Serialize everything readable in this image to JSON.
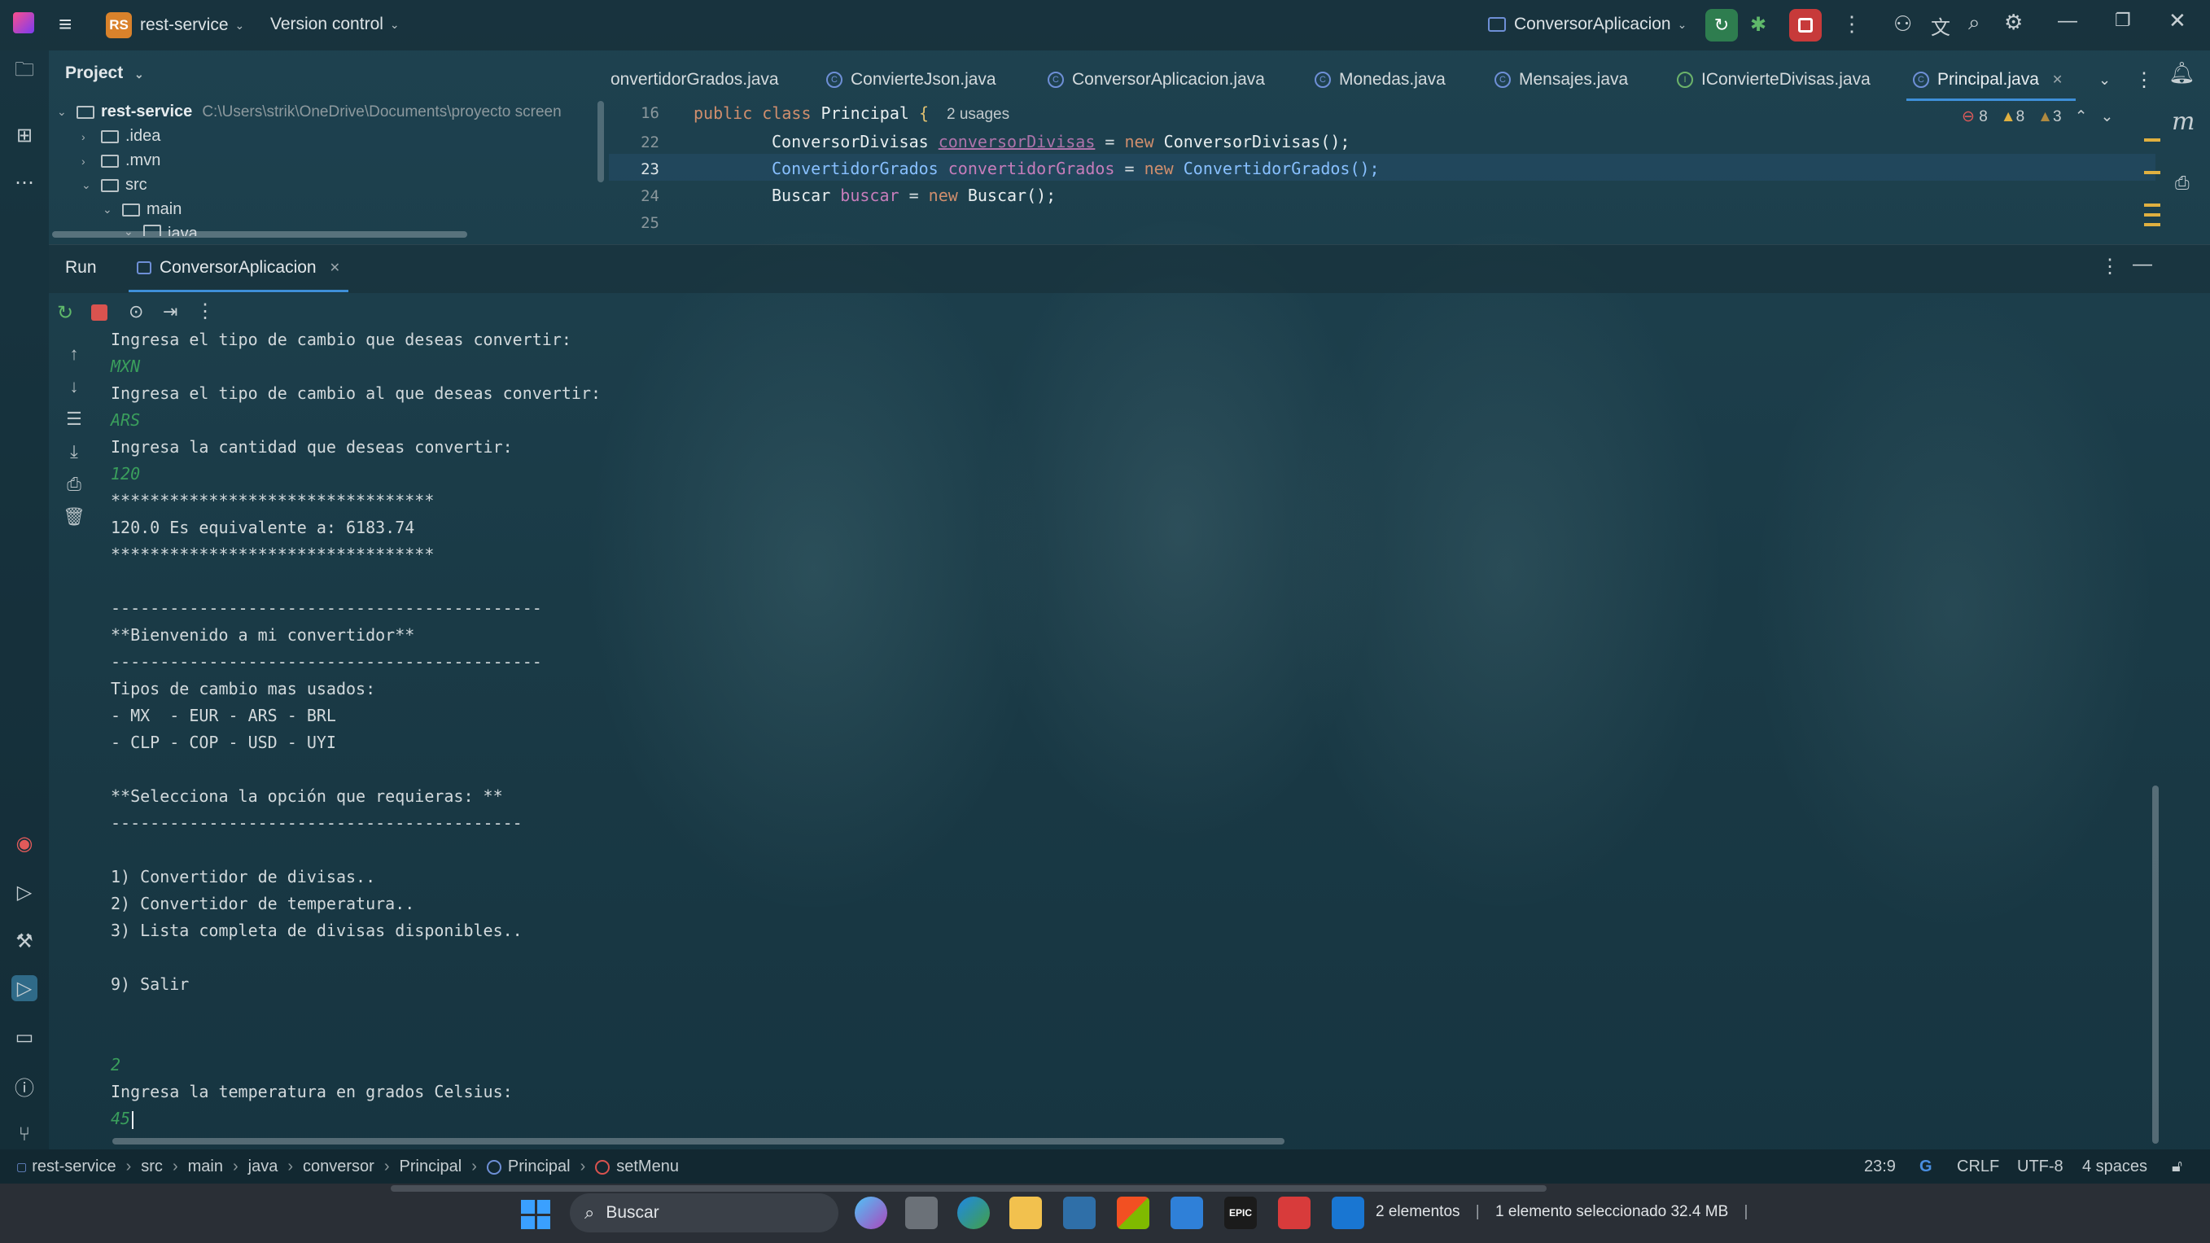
{
  "titlebar": {
    "project_badge": "RS",
    "project_name": "rest-service",
    "vcs": "Version control",
    "run_config": "ConversorAplicacion"
  },
  "project_panel": {
    "title": "Project",
    "tree": [
      {
        "label": "rest-service",
        "path": "C:\\Users\\strik\\OneDrive\\Documents\\proyecto screen"
      },
      {
        "label": ".idea"
      },
      {
        "label": ".mvn"
      },
      {
        "label": "src"
      },
      {
        "label": "main"
      },
      {
        "label": "java"
      }
    ]
  },
  "tabs": [
    {
      "label": "onvertidorGrados.java"
    },
    {
      "label": "ConvierteJson.java"
    },
    {
      "label": "ConversorAplicacion.java"
    },
    {
      "label": "Monedas.java"
    },
    {
      "label": "Mensajes.java"
    },
    {
      "label": "IConvierteDivisas.java"
    },
    {
      "label": "Principal.java"
    }
  ],
  "editor": {
    "inspections": {
      "errors": "8",
      "warnings": "8",
      "weak": "3"
    },
    "line_numbers": [
      "16",
      "22",
      "23",
      "24",
      "25"
    ],
    "line16": {
      "kw": "public class ",
      "cls": "Principal",
      "brace": " {",
      "usages": "2 usages"
    },
    "line22": {
      "type": "ConversorDivisas ",
      "var": "conversorDivisas",
      "eq": " = ",
      "kw": "new ",
      "ctor": "ConversorDivisas();"
    },
    "line23": {
      "type": "ConvertidorGrados ",
      "var": "convertidorGrados",
      "eq": " = ",
      "kw": "new ",
      "ctor": "ConvertidorGrados();"
    },
    "line24": {
      "type": "Buscar ",
      "var": "buscar",
      "eq": " = ",
      "kw": "new ",
      "ctor": "Buscar();"
    }
  },
  "run_panel": {
    "title": "Run",
    "tab": "ConversorAplicacion"
  },
  "console": [
    {
      "text": "Ingresa el tipo de cambio que deseas convertir:",
      "input": false
    },
    {
      "text": "MXN",
      "input": true
    },
    {
      "text": "Ingresa el tipo de cambio al que deseas convertir:",
      "input": false
    },
    {
      "text": "ARS",
      "input": true
    },
    {
      "text": "Ingresa la cantidad que deseas convertir:",
      "input": false
    },
    {
      "text": "120",
      "input": true
    },
    {
      "text": "*********************************",
      "input": false
    },
    {
      "text": "120.0 Es equivalente a: 6183.74",
      "input": false
    },
    {
      "text": "*********************************",
      "input": false
    },
    {
      "text": "",
      "input": false
    },
    {
      "text": "--------------------------------------------",
      "input": false
    },
    {
      "text": "**Bienvenido a mi convertidor**",
      "input": false
    },
    {
      "text": "--------------------------------------------",
      "input": false
    },
    {
      "text": "Tipos de cambio mas usados:",
      "input": false
    },
    {
      "text": "- MX  - EUR - ARS - BRL",
      "input": false
    },
    {
      "text": "- CLP - COP - USD - UYI",
      "input": false
    },
    {
      "text": "",
      "input": false
    },
    {
      "text": "**Selecciona la opción que requieras: **",
      "input": false
    },
    {
      "text": "------------------------------------------",
      "input": false
    },
    {
      "text": "",
      "input": false
    },
    {
      "text": "1) Convertidor de divisas..",
      "input": false
    },
    {
      "text": "2) Convertidor de temperatura..",
      "input": false
    },
    {
      "text": "3) Lista completa de divisas disponibles..",
      "input": false
    },
    {
      "text": "",
      "input": false
    },
    {
      "text": "9) Salir",
      "input": false
    },
    {
      "text": "",
      "input": false
    },
    {
      "text": "",
      "input": false
    },
    {
      "text": "2",
      "input": true
    },
    {
      "text": "Ingresa la temperatura en grados Celsius:",
      "input": false
    },
    {
      "text": "45",
      "input": true
    }
  ],
  "statusbar": {
    "breadcrumb": [
      "rest-service",
      "src",
      "main",
      "java",
      "conversor",
      "Principal",
      "Principal",
      "setMenu"
    ],
    "position": "23:9",
    "line_sep": "CRLF",
    "encoding": "UTF-8",
    "indent": "4 spaces"
  },
  "taskbar": {
    "search": "Buscar",
    "explorer_status": "2 elementos",
    "explorer_selection": "1 elemento seleccionado  32.4 MB"
  },
  "colors": {
    "accent": "#3e8fd8",
    "console_input": "#3a9e5c",
    "keyword": "#cf8e6d",
    "field": "#c77dbb"
  }
}
